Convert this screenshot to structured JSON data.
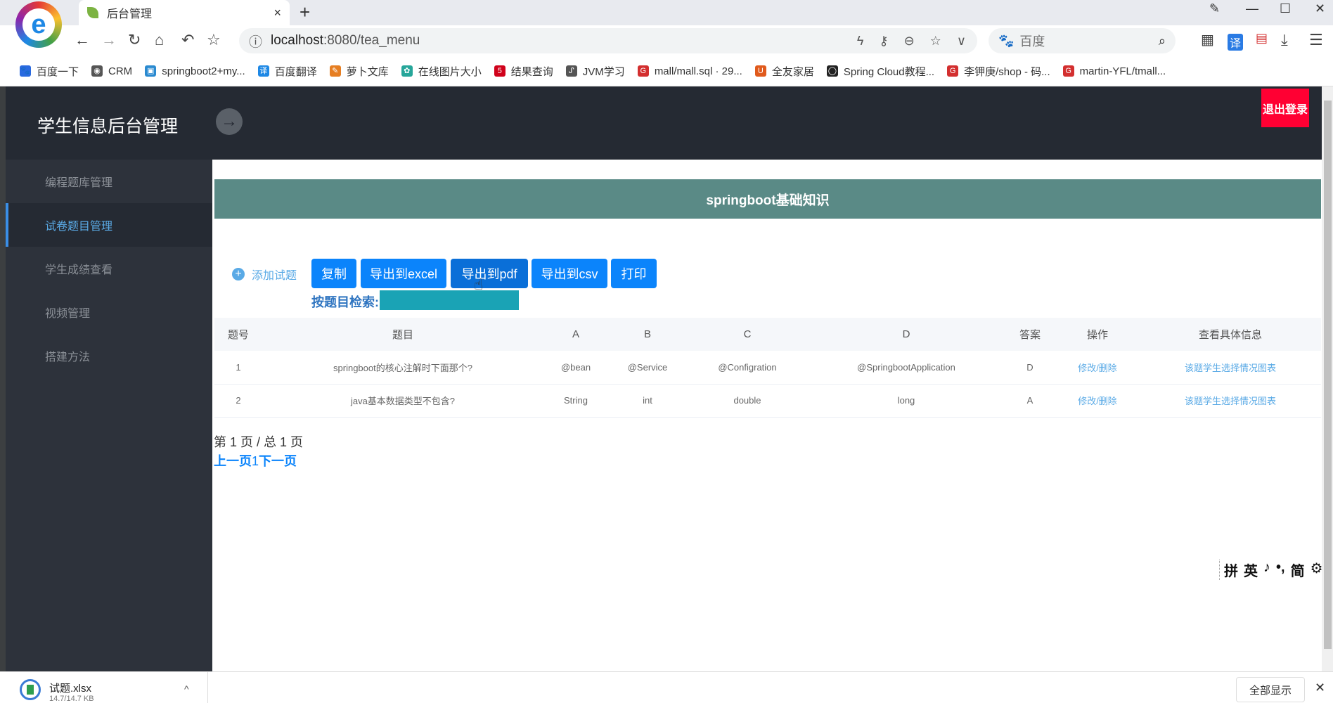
{
  "browser": {
    "tab_title": "后台管理",
    "tab_close": "×",
    "new_tab": "+",
    "url_host": "localhost",
    "url_path": ":8080/tea_menu",
    "search_placeholder": "百度",
    "bookmarks": [
      "百度一下",
      "CRM",
      "springboot2+my...",
      "百度翻译",
      "萝卜文库",
      "在线图片大小",
      "结果查询",
      "JVM学习",
      "mall/mall.sql · 29...",
      "全友家居",
      "Spring Cloud教程...",
      "李钾庚/shop - 码...",
      "martin-YFL/tmall..."
    ],
    "bookmark_colors": [
      "#2a6ae0",
      "#555555",
      "#2a8ad0",
      "#1e88e5",
      "#e67e22",
      "#26a69a",
      "#d0021b",
      "#555555",
      "#d32f2f",
      "#e05a1c",
      "#222222",
      "#d32f2f",
      "#d32f2f"
    ]
  },
  "header": {
    "title": "学生信息后台管理",
    "toggle": "→",
    "logout": "退出登录"
  },
  "sidebar": {
    "items": [
      {
        "label": "编程题库管理",
        "active": false
      },
      {
        "label": "试卷题目管理",
        "active": true
      },
      {
        "label": "学生成绩查看",
        "active": false
      },
      {
        "label": "视频管理",
        "active": false
      },
      {
        "label": "搭建方法",
        "active": false
      }
    ]
  },
  "main": {
    "banner": "springboot基础知识",
    "add_question": "添加试题",
    "buttons": [
      "复制",
      "导出到excel",
      "导出到pdf",
      "导出到csv",
      "打印"
    ],
    "search_label": "按题目检索:",
    "search_value": "",
    "table": {
      "headers": [
        "题号",
        "题目",
        "A",
        "B",
        "C",
        "D",
        "答案",
        "操作",
        "查看具体信息"
      ],
      "rows": [
        [
          "1",
          "springboot的核心注解时下面那个?",
          "@bean",
          "@Service",
          "@Configration",
          "@SpringbootApplication",
          "D",
          "修改/删除",
          "该题学生选择情况图表"
        ],
        [
          "2",
          "java基本数据类型不包含?",
          "String",
          "int",
          "double",
          "long",
          "A",
          "修改/删除",
          "该题学生选择情况图表"
        ]
      ]
    },
    "page_info": "第 1 页 / 总 1 页",
    "pager": {
      "prev": "上一页",
      "current": "1",
      "next": "下一页"
    }
  },
  "ime": [
    "拼",
    "英",
    "♪",
    "•,",
    "简",
    "⚙"
  ],
  "download": {
    "filename": "试题.xlsx",
    "size": "14.7/14.7 KB",
    "show_all": "全部显示",
    "close": "✕",
    "chevron": "^"
  }
}
